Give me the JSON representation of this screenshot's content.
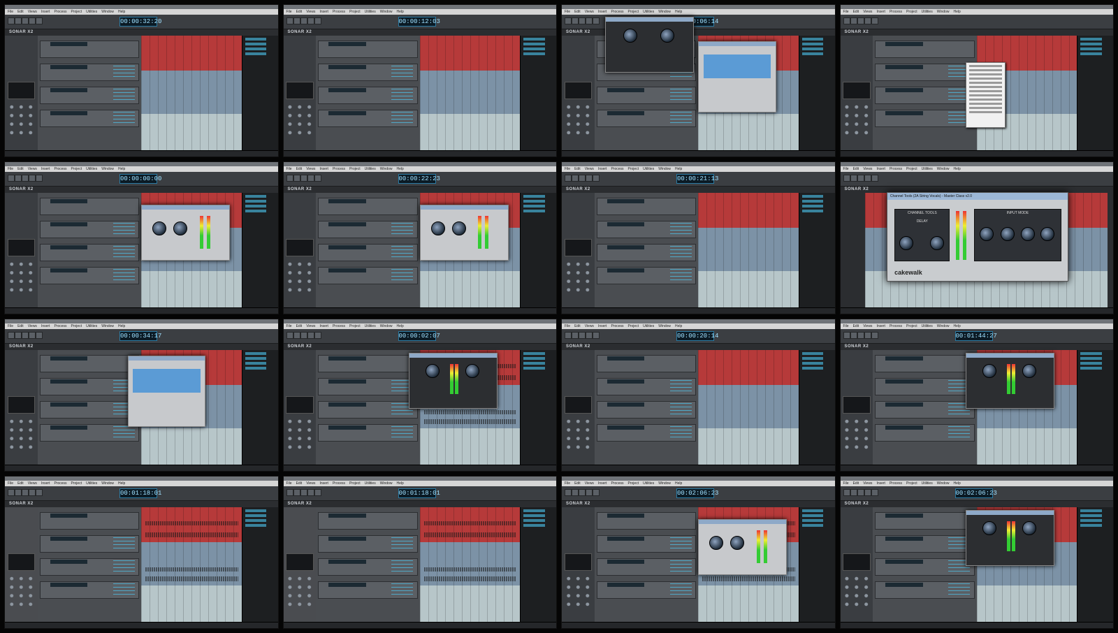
{
  "app": {
    "brand": "SONAR X2",
    "menu": [
      "File",
      "Edit",
      "Views",
      "Insert",
      "Process",
      "Project",
      "Utilities",
      "Window",
      "Help"
    ]
  },
  "tiles": [
    {
      "timecode": "00:00:32:20",
      "variant": "tracks"
    },
    {
      "timecode": "00:00:12:03",
      "variant": "tracks"
    },
    {
      "timecode": "00:00:06:14",
      "variant": "plugins-two"
    },
    {
      "timecode": "",
      "variant": "context-menu"
    },
    {
      "timecode": "00:00:00:00",
      "variant": "plugin-light"
    },
    {
      "timecode": "00:00:22:23",
      "variant": "plugin-light"
    },
    {
      "timecode": "00:00:21:13",
      "variant": "tracks"
    },
    {
      "timecode": "",
      "variant": "big-plugin"
    },
    {
      "timecode": "00:00:34:17",
      "variant": "plugin-eq"
    },
    {
      "timecode": "00:00:02:07",
      "variant": "plugin-dark"
    },
    {
      "timecode": "00:00:20:14",
      "variant": "tracks"
    },
    {
      "timecode": "00:01:44:27",
      "variant": "plugin-dark"
    },
    {
      "timecode": "00:01:18:01",
      "variant": "zoom"
    },
    {
      "timecode": "00:01:18:01",
      "variant": "zoom"
    },
    {
      "timecode": "00:02:06:23",
      "variant": "plugin-light"
    },
    {
      "timecode": "00:02:06:23",
      "variant": "plugin-dark"
    }
  ],
  "big_plugin": {
    "title": "Channel Tools (2A String Vocals) - Master Class v2.0",
    "section_left": "CHANNEL TOOLS",
    "section_delay": "DELAY",
    "section_right": "INPUT MODE",
    "brand": "cakewalk"
  },
  "colors": {
    "clip_red": "#b63a3a",
    "clip_blue": "#7c92a6",
    "clip_light": "#b7c6c9",
    "accent": "#4cc7f0"
  }
}
